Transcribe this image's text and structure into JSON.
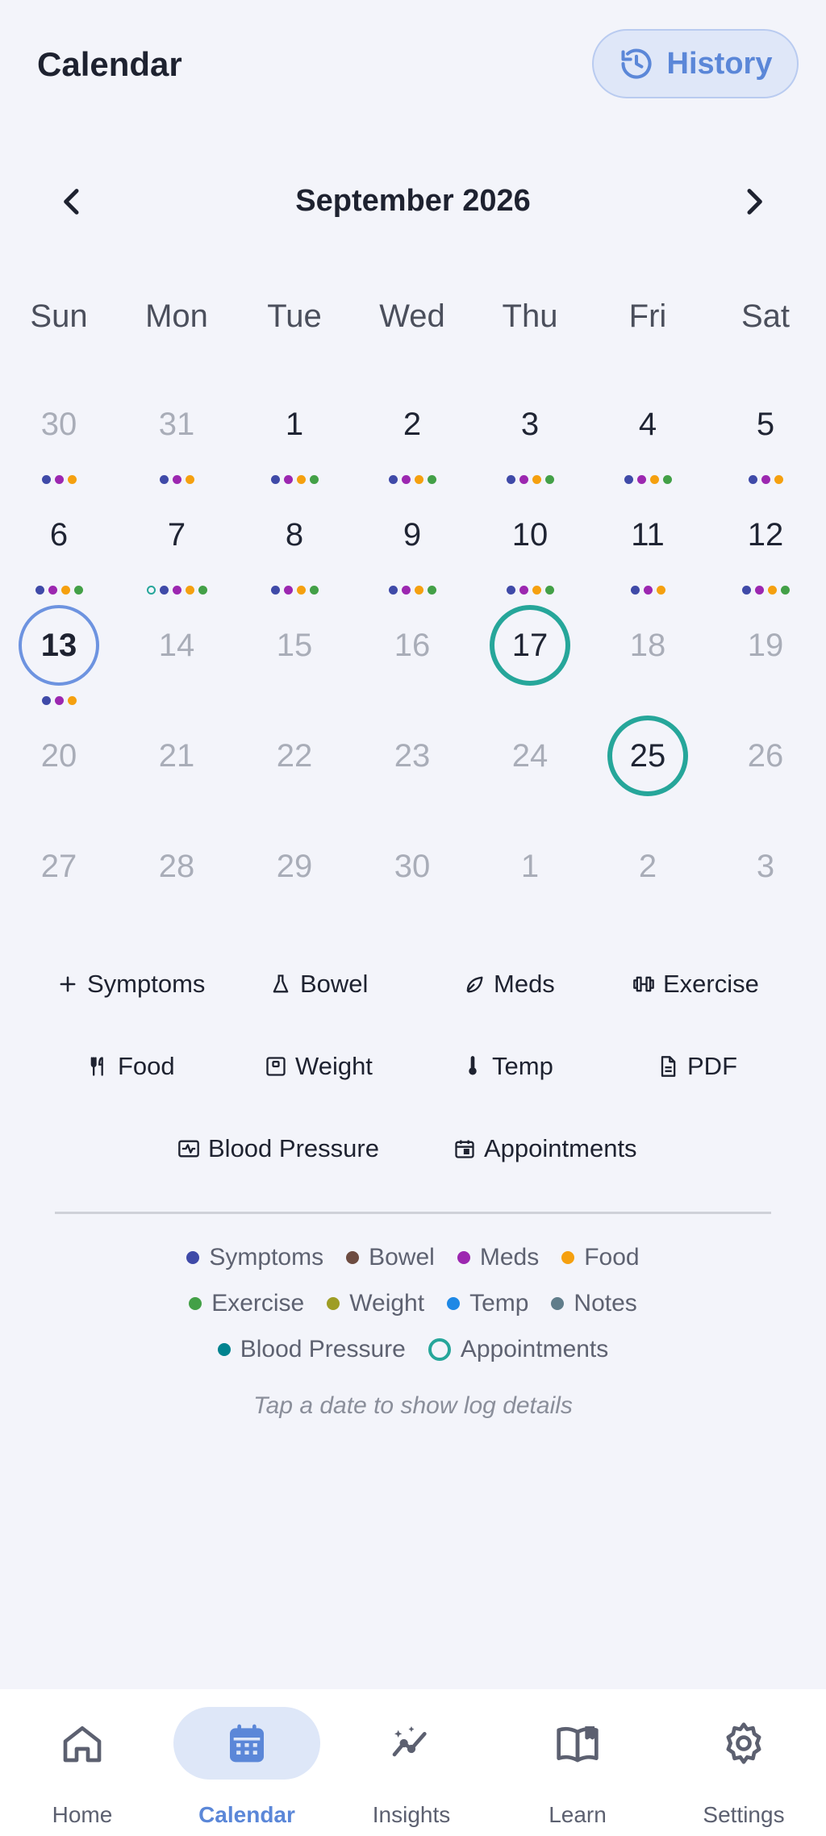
{
  "header": {
    "title": "Calendar",
    "history_label": "History"
  },
  "month": {
    "label": "September 2026"
  },
  "weekdays": [
    "Sun",
    "Mon",
    "Tue",
    "Wed",
    "Thu",
    "Fri",
    "Sat"
  ],
  "colors": {
    "symptoms": "#3f4aa8",
    "bowel": "#6d4c41",
    "meds": "#9c27b0",
    "food": "#f5a00f",
    "exercise": "#43a047",
    "weight": "#9e9d24",
    "temp": "#1e88e5",
    "notes": "#607d8b",
    "blood_pressure": "#00838f",
    "appointments": "#26a69a"
  },
  "days": [
    {
      "n": "30",
      "muted": true,
      "dots": [
        "symptoms",
        "meds",
        "food"
      ]
    },
    {
      "n": "31",
      "muted": true,
      "dots": [
        "symptoms",
        "meds",
        "food"
      ]
    },
    {
      "n": "1",
      "muted": false,
      "dots": [
        "symptoms",
        "meds",
        "food",
        "exercise"
      ]
    },
    {
      "n": "2",
      "muted": false,
      "dots": [
        "symptoms",
        "meds",
        "food",
        "exercise"
      ]
    },
    {
      "n": "3",
      "muted": false,
      "dots": [
        "symptoms",
        "meds",
        "food",
        "exercise"
      ]
    },
    {
      "n": "4",
      "muted": false,
      "dots": [
        "symptoms",
        "meds",
        "food",
        "exercise"
      ]
    },
    {
      "n": "5",
      "muted": false,
      "dots": [
        "symptoms",
        "meds",
        "food"
      ]
    },
    {
      "n": "6",
      "muted": false,
      "dots": [
        "symptoms",
        "meds",
        "food",
        "exercise"
      ]
    },
    {
      "n": "7",
      "muted": false,
      "dots": [
        "appt-ring",
        "symptoms",
        "meds",
        "food",
        "exercise"
      ]
    },
    {
      "n": "8",
      "muted": false,
      "dots": [
        "symptoms",
        "meds",
        "food",
        "exercise"
      ]
    },
    {
      "n": "9",
      "muted": false,
      "dots": [
        "symptoms",
        "meds",
        "food",
        "exercise"
      ]
    },
    {
      "n": "10",
      "muted": false,
      "dots": [
        "symptoms",
        "meds",
        "food",
        "exercise"
      ]
    },
    {
      "n": "11",
      "muted": false,
      "dots": [
        "symptoms",
        "meds",
        "food"
      ]
    },
    {
      "n": "12",
      "muted": false,
      "dots": [
        "symptoms",
        "meds",
        "food",
        "exercise"
      ]
    },
    {
      "n": "13",
      "muted": false,
      "today": true,
      "dots": [
        "symptoms",
        "meds",
        "food"
      ]
    },
    {
      "n": "14",
      "muted": true,
      "dots": []
    },
    {
      "n": "15",
      "muted": true,
      "dots": []
    },
    {
      "n": "16",
      "muted": true,
      "dots": []
    },
    {
      "n": "17",
      "muted": false,
      "appt": true,
      "dots": []
    },
    {
      "n": "18",
      "muted": true,
      "dots": []
    },
    {
      "n": "19",
      "muted": true,
      "dots": []
    },
    {
      "n": "20",
      "muted": true,
      "dots": []
    },
    {
      "n": "21",
      "muted": true,
      "dots": []
    },
    {
      "n": "22",
      "muted": true,
      "dots": []
    },
    {
      "n": "23",
      "muted": true,
      "dots": []
    },
    {
      "n": "24",
      "muted": true,
      "dots": []
    },
    {
      "n": "25",
      "muted": false,
      "appt": true,
      "dots": []
    },
    {
      "n": "26",
      "muted": true,
      "dots": []
    },
    {
      "n": "27",
      "muted": true,
      "dots": []
    },
    {
      "n": "28",
      "muted": true,
      "dots": []
    },
    {
      "n": "29",
      "muted": true,
      "dots": []
    },
    {
      "n": "30",
      "muted": true,
      "dots": []
    },
    {
      "n": "1",
      "muted": true,
      "dots": []
    },
    {
      "n": "2",
      "muted": true,
      "dots": []
    },
    {
      "n": "3",
      "muted": true,
      "dots": []
    }
  ],
  "quick_add": {
    "symptoms": "Symptoms",
    "bowel": "Bowel",
    "meds": "Meds",
    "exercise": "Exercise",
    "food": "Food",
    "weight": "Weight",
    "temp": "Temp",
    "pdf": "PDF",
    "blood_pressure": "Blood Pressure",
    "appointments": "Appointments"
  },
  "legend": {
    "symptoms": "Symptoms",
    "bowel": "Bowel",
    "meds": "Meds",
    "food": "Food",
    "exercise": "Exercise",
    "weight": "Weight",
    "temp": "Temp",
    "notes": "Notes",
    "blood_pressure": "Blood Pressure",
    "appointments": "Appointments"
  },
  "hint": "Tap a date to show log details",
  "nav": {
    "home": "Home",
    "calendar": "Calendar",
    "insights": "Insights",
    "learn": "Learn",
    "settings": "Settings"
  }
}
